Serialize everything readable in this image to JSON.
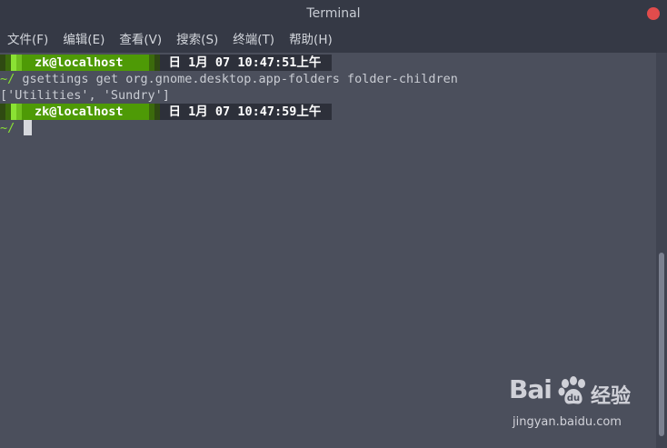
{
  "window": {
    "title": "Terminal"
  },
  "menu": {
    "items": [
      {
        "label": "文件(F)"
      },
      {
        "label": "编辑(E)"
      },
      {
        "label": "查看(V)"
      },
      {
        "label": "搜索(S)"
      },
      {
        "label": "终端(T)"
      },
      {
        "label": "帮助(H)"
      }
    ]
  },
  "terminal": {
    "prompt1": {
      "host": "zk@localhost",
      "datetime": "日 1月  07 10:47:51上午"
    },
    "cwd1": "~/",
    "command1": "gsettings get org.gnome.desktop.app-folders folder-children",
    "output1": "['Utilities', 'Sundry']",
    "prompt2": {
      "host": "zk@localhost",
      "datetime": "日 1月  07 10:47:59上午"
    },
    "cwd2": "~/"
  },
  "watermark": {
    "brand": "Bai",
    "brand_suffix": "经验",
    "url": "jingyan.baidu.com"
  },
  "colors": {
    "background": "#4b4f5c",
    "titlebar": "#353945",
    "prompt_green": "#4e9a06",
    "tilde_green": "#8ae234",
    "close_red": "#e14c4c"
  }
}
